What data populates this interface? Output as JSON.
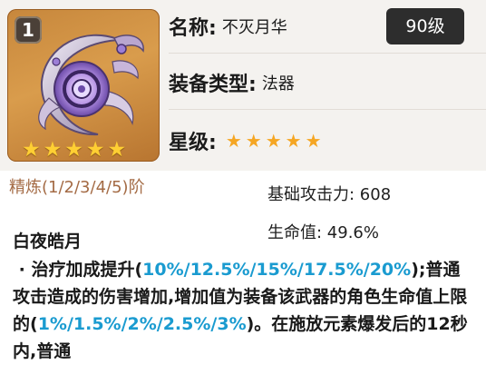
{
  "weapon_card": {
    "rank": "1",
    "star_count": 5,
    "art_icon": "catalyst-orb-icon",
    "colors": {
      "frame": "#c7873c",
      "star": "#ffcf33"
    }
  },
  "info": {
    "name_label": "名称:",
    "name_value": "不灭月华",
    "level_badge": "90级",
    "type_label": "装备类型:",
    "type_value": "法器",
    "rarity_label": "星级:",
    "rarity_count": 5
  },
  "stats": {
    "refine_label": "精炼(1/2/3/4/5)阶",
    "base_atk": "基础攻击力: 608",
    "sub_stat": "生命值: 49.6%"
  },
  "passive": {
    "title": "白夜皓月",
    "desc": [
      {
        "text": " · 治疗加成提升(",
        "hl": false
      },
      {
        "text": "10%/12.5%/15%/17.5%/20%",
        "hl": true
      },
      {
        "text": ");普通攻击造成的伤害增加,增加值为装备该武器的角色生命值上限的(",
        "hl": false
      },
      {
        "text": "1%/1.5%/2%/2.5%/3%",
        "hl": true
      },
      {
        "text": ")。在施放元素爆发后的12秒内,普通",
        "hl": false
      }
    ],
    "highlight_color": "#1a9bd0"
  }
}
